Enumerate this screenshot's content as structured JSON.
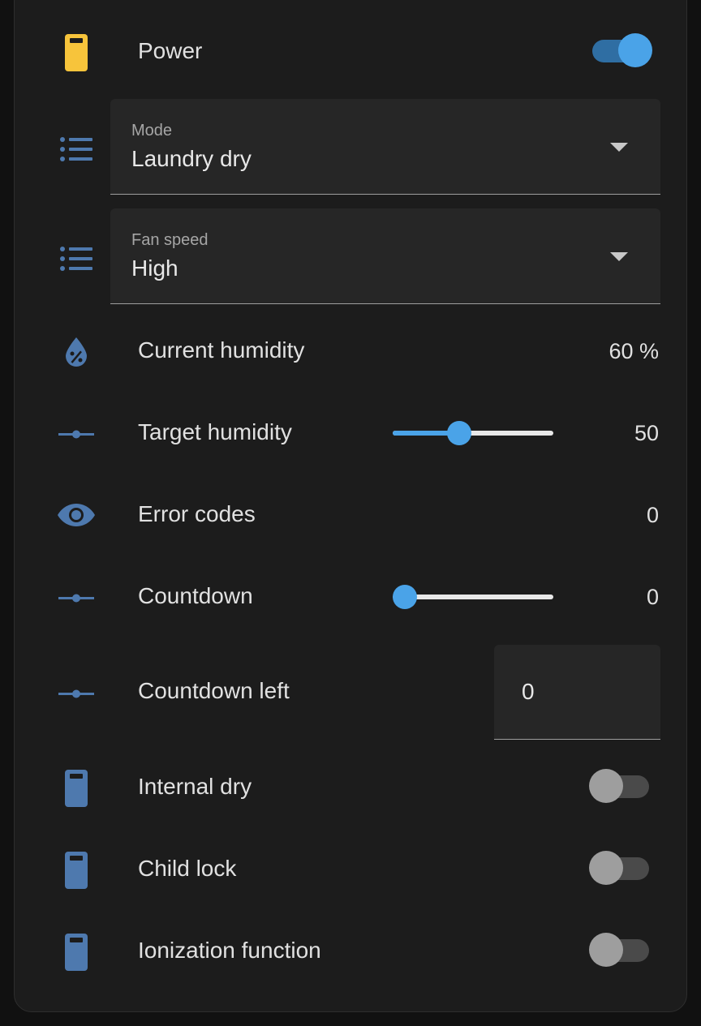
{
  "colors": {
    "accent": "#4aa3e8",
    "icon_blue": "#4e79ae",
    "icon_yellow": "#f7c43b",
    "toggle_off_thumb": "#9e9e9e",
    "toggle_off_track": "#4a4a4a"
  },
  "power": {
    "label": "Power",
    "icon": "device-icon",
    "on": true
  },
  "mode": {
    "icon": "list-icon",
    "field_label": "Mode",
    "value": "Laundry dry"
  },
  "fan_speed": {
    "icon": "list-icon",
    "field_label": "Fan speed",
    "value": "High"
  },
  "current_humidity": {
    "icon": "water-percent-icon",
    "label": "Current humidity",
    "value": "60 %"
  },
  "target_humidity": {
    "icon": "ray-vertex-icon",
    "label": "Target humidity",
    "value": "50",
    "slider_fraction": 0.4
  },
  "error_codes": {
    "icon": "eye-icon",
    "label": "Error codes",
    "value": "0"
  },
  "countdown": {
    "icon": "ray-vertex-icon",
    "label": "Countdown",
    "value": "0",
    "slider_fraction": 0
  },
  "countdown_left": {
    "icon": "ray-vertex-icon",
    "label": "Countdown left",
    "value": "0"
  },
  "internal_dry": {
    "icon": "device-icon",
    "label": "Internal dry",
    "on": false
  },
  "child_lock": {
    "icon": "device-icon",
    "label": "Child lock",
    "on": false
  },
  "ionization": {
    "icon": "device-icon",
    "label": "Ionization function",
    "on": false
  }
}
